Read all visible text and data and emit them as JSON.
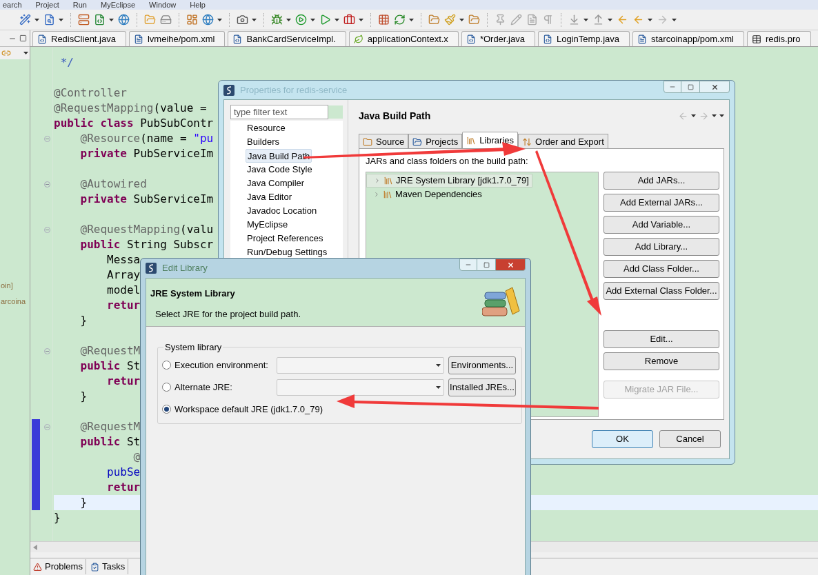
{
  "menu": [
    "earch",
    "Project",
    "Run",
    "MyEclipse",
    "Window",
    "Help"
  ],
  "editor_tabs": [
    {
      "label": "RedisClient.java",
      "kind": "java"
    },
    {
      "label": "lvmeihe/pom.xml",
      "kind": "maven"
    },
    {
      "label": "BankCardServiceImpl.",
      "kind": "java"
    },
    {
      "label": "applicationContext.x",
      "kind": "spring"
    },
    {
      "label": "*Order.java",
      "kind": "java"
    },
    {
      "label": "LoginTemp.java",
      "kind": "java"
    },
    {
      "label": "starcoinapp/pom.xml",
      "kind": "maven"
    },
    {
      "label": "redis.pro",
      "kind": "props"
    }
  ],
  "package_explorer": {
    "items": [
      "oin]",
      "arcoina"
    ]
  },
  "code_blocks": [
    {
      "lines": [
        {
          "segments": [
            {
              "text": " */",
              "kind": "comment"
            }
          ]
        }
      ]
    },
    {
      "lines": [
        {
          "segments": [
            {
              "text": "@Controller",
              "kind": "annotation"
            }
          ]
        },
        {
          "segments": [
            {
              "text": "@RequestMapping",
              "kind": "annotation"
            },
            {
              "text": "(value = ",
              "kind": "plain"
            }
          ]
        },
        {
          "segments": [
            {
              "text": "public class ",
              "kind": "keyword"
            },
            {
              "text": "PubSubContr",
              "kind": "plain"
            }
          ]
        },
        {
          "fold": true,
          "segments": [
            {
              "text": "    @Resource",
              "kind": "annotation"
            },
            {
              "text": "(name = ",
              "kind": "plain"
            },
            {
              "text": "\"pu",
              "kind": "string"
            }
          ]
        },
        {
          "segments": [
            {
              "text": "    private ",
              "kind": "keyword"
            },
            {
              "text": "PubServiceIm",
              "kind": "plain"
            }
          ]
        }
      ]
    },
    {
      "lines": [
        {
          "fold": true,
          "segments": [
            {
              "text": "    @Autowired",
              "kind": "annotation"
            }
          ]
        },
        {
          "segments": [
            {
              "text": "    private ",
              "kind": "keyword"
            },
            {
              "text": "SubServiceIm",
              "kind": "plain"
            }
          ]
        }
      ]
    },
    {
      "lines": [
        {
          "fold": true,
          "segments": [
            {
              "text": "    @RequestMapping",
              "kind": "annotation"
            },
            {
              "text": "(valu",
              "kind": "plain"
            }
          ]
        },
        {
          "segments": [
            {
              "text": "    public ",
              "kind": "keyword"
            },
            {
              "text": "String Subscr",
              "kind": "plain"
            }
          ]
        },
        {
          "segments": [
            {
              "text": "        Messa",
              "kind": "plain"
            }
          ]
        },
        {
          "segments": [
            {
              "text": "        Array",
              "kind": "plain"
            }
          ]
        },
        {
          "segments": [
            {
              "text": "        model",
              "kind": "plain"
            }
          ]
        },
        {
          "segments": [
            {
              "text": "        retur",
              "kind": "keyword"
            }
          ]
        },
        {
          "segments": [
            {
              "text": "    }",
              "kind": "plain"
            }
          ]
        }
      ]
    },
    {
      "lines": [
        {
          "fold": true,
          "segments": [
            {
              "text": "    @RequestM",
              "kind": "annotation"
            }
          ]
        },
        {
          "segments": [
            {
              "text": "    public ",
              "kind": "keyword"
            },
            {
              "text": "St",
              "kind": "plain"
            }
          ]
        },
        {
          "segments": [
            {
              "text": "        retur",
              "kind": "keyword"
            }
          ]
        },
        {
          "segments": [
            {
              "text": "    }",
              "kind": "plain"
            }
          ]
        }
      ]
    },
    {
      "lines": [
        {
          "fold": true,
          "changed": true,
          "segments": [
            {
              "text": "    @RequestM",
              "kind": "annotation"
            }
          ]
        },
        {
          "changed": true,
          "segments": [
            {
              "text": "    public ",
              "kind": "keyword"
            },
            {
              "text": "St",
              "kind": "plain"
            }
          ]
        },
        {
          "changed": true,
          "segments": [
            {
              "text": "            @",
              "kind": "annotation"
            }
          ]
        },
        {
          "changed": true,
          "segments": [
            {
              "text": "        pubSe",
              "kind": "field"
            }
          ]
        },
        {
          "changed": true,
          "segments": [
            {
              "text": "        retur",
              "kind": "keyword"
            }
          ]
        },
        {
          "changed": true,
          "current": true,
          "segments": [
            {
              "text": "    }",
              "kind": "plain"
            }
          ]
        },
        {
          "segments": [
            {
              "text": "}",
              "kind": "plain"
            }
          ]
        }
      ]
    }
  ],
  "bottom_tabs": [
    "Problems",
    "Tasks"
  ],
  "properties_dialog": {
    "title": "Properties for redis-service",
    "filter": {
      "placeholder": "type filter text"
    },
    "tree": [
      {
        "label": "Resource",
        "selected": false
      },
      {
        "label": "Builders",
        "selected": false
      },
      {
        "label": "Java Build Path",
        "selected": true
      },
      {
        "label": "Java Code Style",
        "selected": false
      },
      {
        "label": "Java Compiler",
        "selected": false
      },
      {
        "label": "Java Editor",
        "selected": false
      },
      {
        "label": "Javadoc Location",
        "selected": false
      },
      {
        "label": "MyEclipse",
        "selected": false
      },
      {
        "label": "Project References",
        "selected": false
      },
      {
        "label": "Run/Debug Settings",
        "selected": false
      }
    ],
    "page_title": "Java Build Path",
    "tabs": [
      {
        "label": "Source",
        "kind": "source",
        "selected": false
      },
      {
        "label": "Projects",
        "kind": "projects",
        "selected": false
      },
      {
        "label": "Libraries",
        "kind": "libraries",
        "selected": true
      },
      {
        "label": "Order and Export",
        "kind": "order",
        "selected": false
      }
    ],
    "list_label": "JARs and class folders on the build path:",
    "libraries": [
      {
        "label": "JRE System Library [jdk1.7.0_79]",
        "selected": true
      },
      {
        "label": "Maven Dependencies",
        "selected": false
      }
    ],
    "side_buttons": [
      {
        "label": "Add JARs...",
        "disabled": false
      },
      {
        "label": "Add External JARs...",
        "disabled": false
      },
      {
        "label": "Add Variable...",
        "disabled": false
      },
      {
        "label": "Add Library...",
        "disabled": false
      },
      {
        "label": "Add Class Folder...",
        "disabled": false
      },
      {
        "label": "Add External Class Folder...",
        "disabled": false
      },
      {
        "label": "Edit...",
        "disabled": false
      },
      {
        "label": "Remove",
        "disabled": false
      },
      {
        "label": "Migrate JAR File...",
        "disabled": true
      }
    ],
    "ok": "OK",
    "cancel": "Cancel"
  },
  "edit_library_dialog": {
    "title": "Edit Library",
    "heading": "JRE System Library",
    "description": "Select JRE for the project build path.",
    "group": "System library",
    "options": [
      {
        "label": "Execution environment:",
        "selected": false,
        "button": "Environments..."
      },
      {
        "label": "Alternate JRE:",
        "selected": false,
        "button": "Installed JREs..."
      },
      {
        "label": "Workspace default JRE (jdk1.7.0_79)",
        "selected": true
      }
    ]
  }
}
